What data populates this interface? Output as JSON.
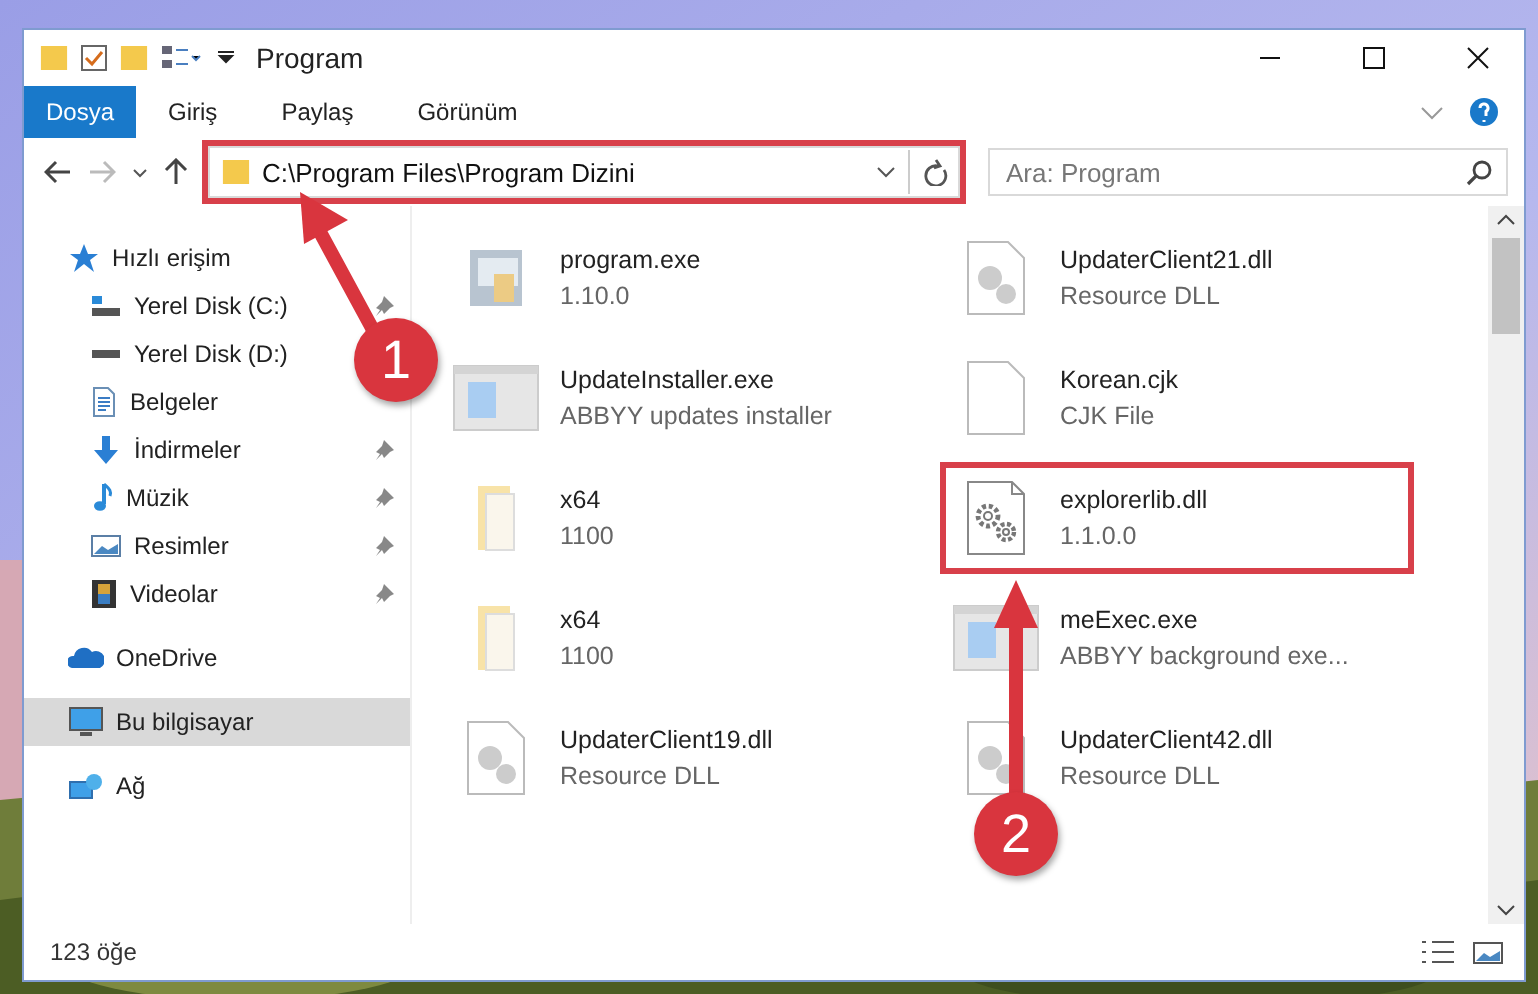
{
  "window": {
    "title": "Program"
  },
  "ribbon_tabs": [
    {
      "label": "Dosya",
      "kind": "file"
    },
    {
      "label": "Giriş",
      "kind": "tab"
    },
    {
      "label": "Paylaş",
      "kind": "tab"
    },
    {
      "label": "Görünüm",
      "kind": "tab"
    }
  ],
  "address_bar": {
    "path": "C:\\Program Files\\Program Dizini",
    "highlighted": true
  },
  "search": {
    "placeholder": "Ara: Program"
  },
  "sidebar": {
    "items": [
      {
        "label": "Hızlı erişim",
        "kind": "star",
        "selected": false,
        "children": [
          {
            "label": "Yerel Disk (C:)",
            "kind": "system",
            "pinned": true,
            "selected": false
          },
          {
            "label": "Yerel Disk (D:)",
            "kind": "drive",
            "pinned": false,
            "selected": false
          },
          {
            "label": "Belgeler",
            "kind": "documents",
            "pinned": false,
            "selected": false
          },
          {
            "label": "İndirmeler",
            "kind": "downloads",
            "pinned": true,
            "selected": false
          },
          {
            "label": "Müzik",
            "kind": "music",
            "pinned": true,
            "selected": false
          },
          {
            "label": "Resimler",
            "kind": "pictures",
            "pinned": true,
            "selected": false
          },
          {
            "label": "Videolar",
            "kind": "videos",
            "pinned": true,
            "selected": false
          }
        ]
      },
      {
        "label": "OneDrive",
        "kind": "cloud",
        "selected": false
      },
      {
        "label": "Bu bilgisayar",
        "kind": "computer",
        "selected": true
      },
      {
        "label": "Ağ",
        "kind": "network",
        "selected": false
      }
    ]
  },
  "files": [
    {
      "name": "program.exe",
      "detail": "1.10.0",
      "kind": "app",
      "highlighted": false
    },
    {
      "name": "UpdaterClient21.dll",
      "detail": "Resource DLL",
      "kind": "dll",
      "highlighted": false
    },
    {
      "name": "UpdateInstaller.exe",
      "detail": "ABBYY updates installer",
      "kind": "window",
      "highlighted": false
    },
    {
      "name": "Korean.cjk",
      "detail": "CJK File",
      "kind": "blank",
      "highlighted": false
    },
    {
      "name": "x64",
      "detail": "1100",
      "kind": "folder",
      "highlighted": false
    },
    {
      "name": "explorerlib.dll",
      "detail": "1.1.0.0",
      "kind": "gears",
      "highlighted": true
    },
    {
      "name": "x64",
      "detail": "1100",
      "kind": "folder",
      "highlighted": false
    },
    {
      "name": "meExec.exe",
      "detail": "ABBYY background exe...",
      "kind": "window",
      "highlighted": false
    },
    {
      "name": "UpdaterClient19.dll",
      "detail": "Resource DLL",
      "kind": "dll",
      "highlighted": false
    },
    {
      "name": "UpdaterClient42.dll",
      "detail": "Resource DLL",
      "kind": "dll",
      "highlighted": false
    }
  ],
  "status_bar": {
    "count": "123 öğe"
  },
  "callouts": [
    {
      "number": "1"
    },
    {
      "number": "2"
    }
  ]
}
